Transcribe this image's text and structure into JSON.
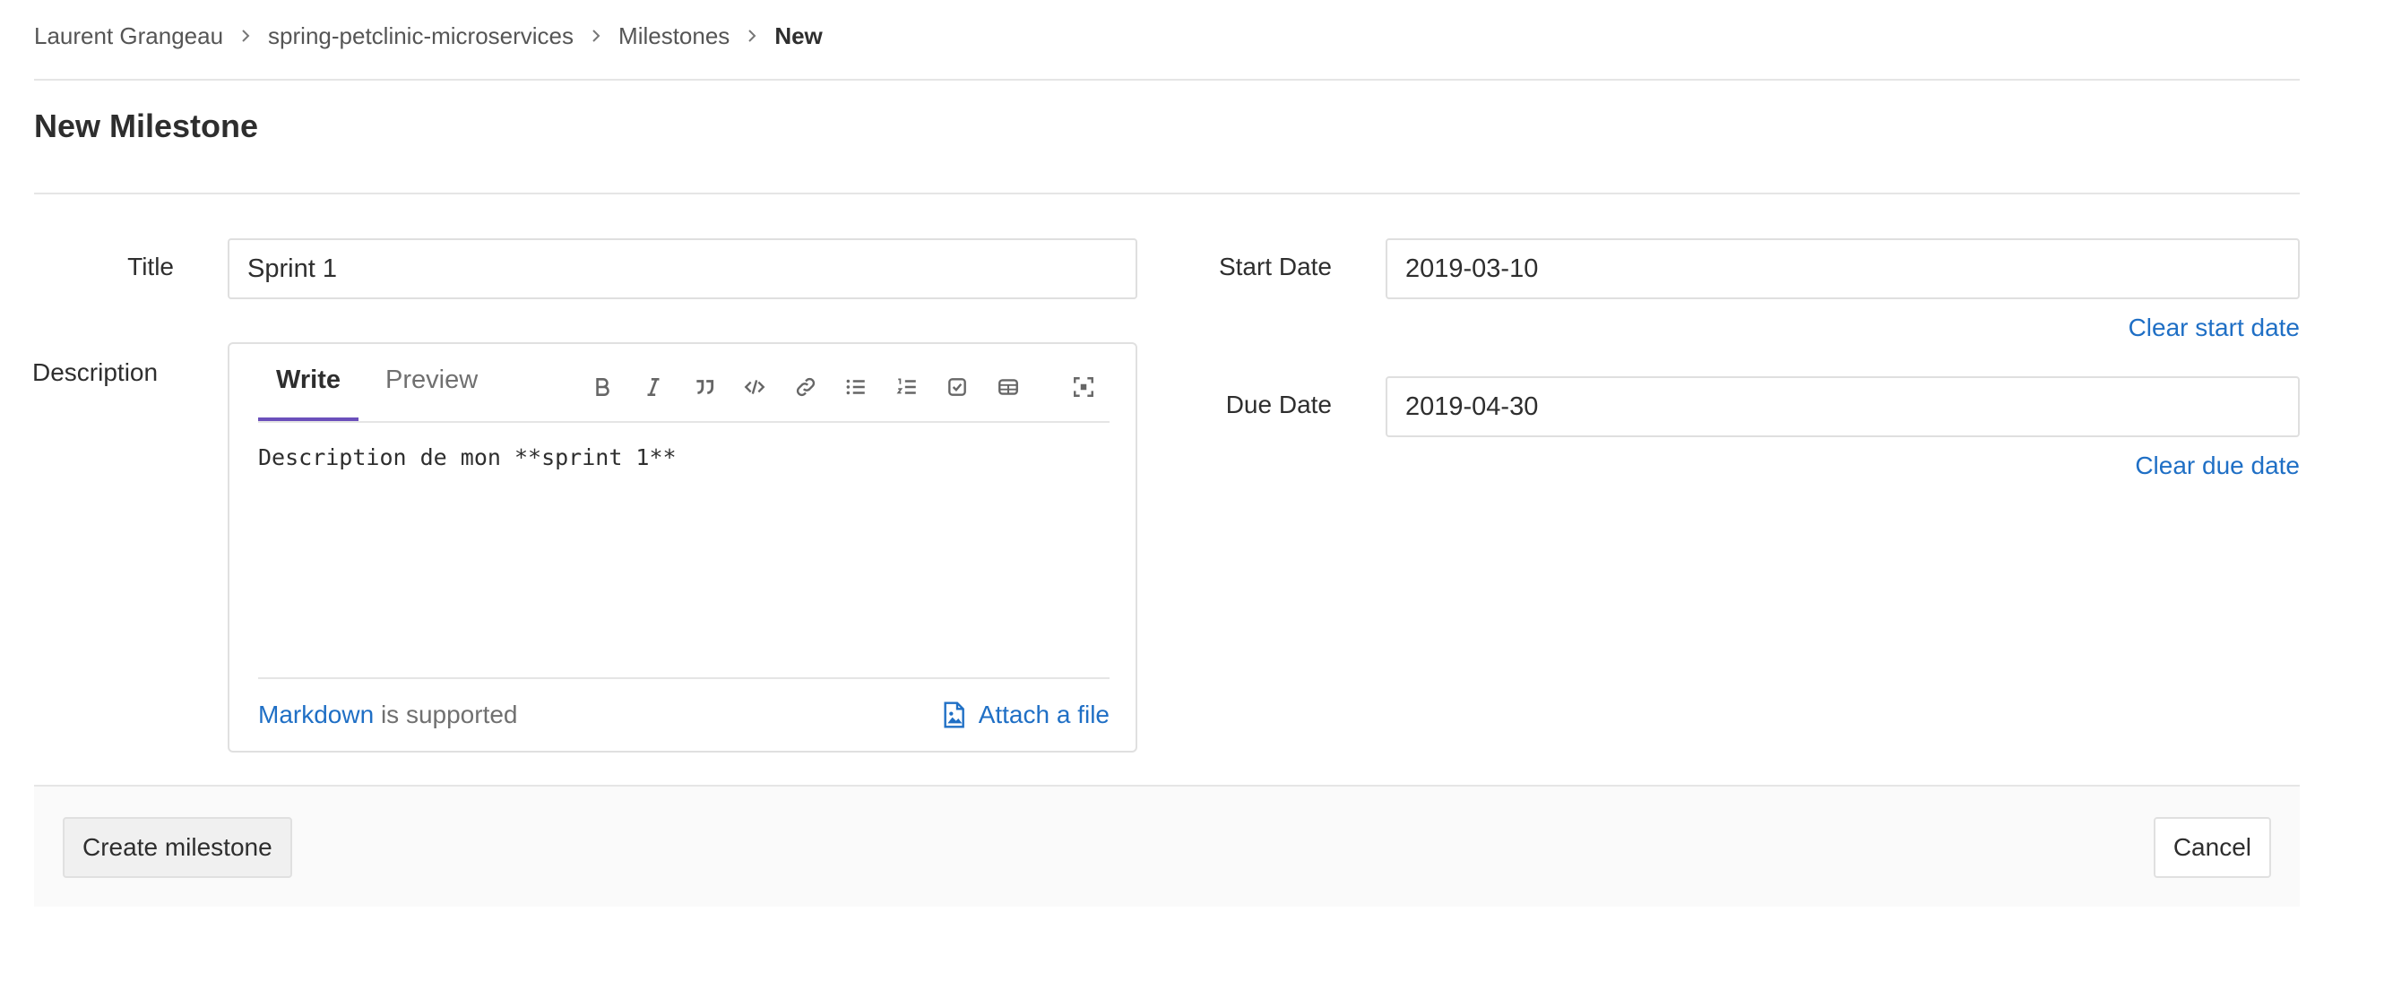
{
  "breadcrumb": {
    "items": [
      "Laurent Grangeau",
      "spring-petclinic-microservices",
      "Milestones"
    ],
    "current": "New"
  },
  "page": {
    "title": "New Milestone"
  },
  "form": {
    "title_label": "Title",
    "title_value": "Sprint 1",
    "description_label": "Description",
    "start_date_label": "Start Date",
    "start_date_value": "2019-03-10",
    "clear_start_label": "Clear start date",
    "due_date_label": "Due Date",
    "due_date_value": "2019-04-30",
    "clear_due_label": "Clear due date"
  },
  "editor": {
    "tabs": [
      {
        "label": "Write",
        "active": true
      },
      {
        "label": "Preview",
        "active": false
      }
    ],
    "toolbar": [
      "bold-icon",
      "italic-icon",
      "quote-icon",
      "code-icon",
      "link-icon",
      "bullet-list-icon",
      "numbered-list-icon",
      "task-list-icon",
      "table-icon",
      "fullscreen-icon"
    ],
    "content": "Description de mon **sprint 1**",
    "markdown_link": "Markdown",
    "markdown_suffix": " is supported",
    "attach_label": "Attach a file"
  },
  "actions": {
    "create_label": "Create milestone",
    "cancel_label": "Cancel"
  },
  "colors": {
    "accent": "#6b4fbb",
    "link": "#1f6fc5"
  }
}
